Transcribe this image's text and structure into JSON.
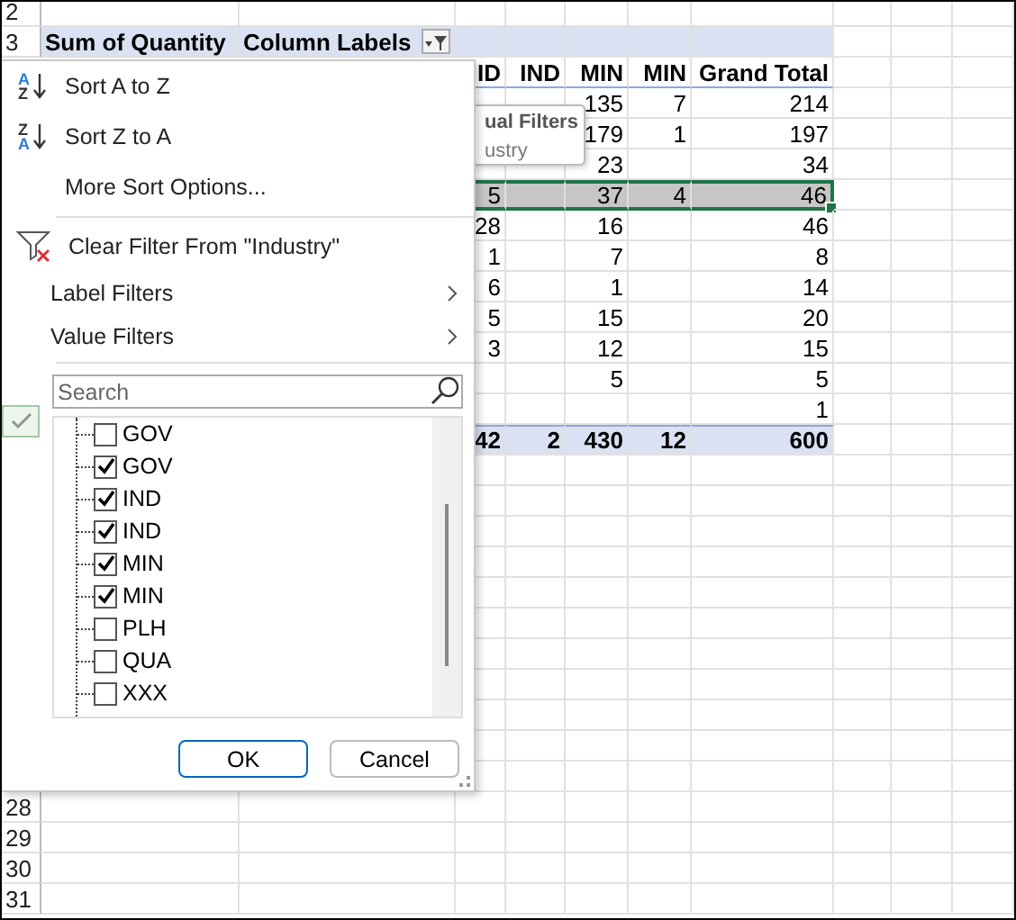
{
  "sheet": {
    "row_headers": [
      "2",
      "3",
      "28",
      "29",
      "30",
      "31"
    ]
  },
  "pivot": {
    "row_label": "Sum of Quantity",
    "column_label": "Column Labels",
    "filter_active": true,
    "columns": [
      "ID",
      "IND",
      "MIN",
      "MIN",
      "Grand Total"
    ],
    "rows": [
      {
        "selected": false,
        "cells": [
          null,
          null,
          "135",
          "7",
          "214"
        ]
      },
      {
        "selected": false,
        "cells": [
          null,
          null,
          "179",
          "1",
          "197"
        ]
      },
      {
        "selected": false,
        "cells": [
          null,
          null,
          "23",
          null,
          "34"
        ]
      },
      {
        "selected": true,
        "cells": [
          "5",
          null,
          "37",
          "4",
          "46"
        ]
      },
      {
        "selected": false,
        "cells": [
          "28",
          null,
          "16",
          null,
          "46"
        ]
      },
      {
        "selected": false,
        "cells": [
          "1",
          null,
          "7",
          null,
          "8"
        ]
      },
      {
        "selected": false,
        "cells": [
          "6",
          null,
          "1",
          null,
          "14"
        ]
      },
      {
        "selected": false,
        "cells": [
          "5",
          null,
          "15",
          null,
          "20"
        ]
      },
      {
        "selected": false,
        "cells": [
          "3",
          null,
          "12",
          null,
          "15"
        ]
      },
      {
        "selected": false,
        "cells": [
          null,
          null,
          "5",
          null,
          "5"
        ]
      },
      {
        "selected": false,
        "cells": [
          null,
          null,
          null,
          null,
          "1"
        ]
      }
    ],
    "total": [
      "42",
      "2",
      "430",
      "12",
      "600"
    ]
  },
  "tooltip": {
    "title": "ual Filters",
    "text": "ustry"
  },
  "filter_menu": {
    "items": [
      {
        "kind": "sort",
        "label": "Sort A to Z",
        "icon_top": "A",
        "icon_bottom": "Z"
      },
      {
        "kind": "sort",
        "label": "Sort Z to A",
        "icon_top": "Z",
        "icon_bottom": "A"
      },
      {
        "kind": "plain",
        "label": "More Sort Options..."
      },
      {
        "kind": "separator"
      },
      {
        "kind": "clear",
        "label": "Clear Filter From \"Industry\""
      },
      {
        "kind": "submenu",
        "label": "Label Filters"
      },
      {
        "kind": "submenu",
        "label": "Value Filters"
      },
      {
        "kind": "separator"
      }
    ],
    "search": {
      "placeholder": "Search"
    },
    "values": [
      {
        "label": "GOV",
        "checked": false
      },
      {
        "label": "GOV",
        "checked": true
      },
      {
        "label": "IND",
        "checked": true
      },
      {
        "label": "IND",
        "checked": true
      },
      {
        "label": "MIN",
        "checked": true
      },
      {
        "label": "MIN",
        "checked": true
      },
      {
        "label": "PLH",
        "checked": false
      },
      {
        "label": "QUA",
        "checked": false
      },
      {
        "label": "XXX",
        "checked": false
      }
    ],
    "buttons": [
      "OK",
      "Cancel"
    ]
  }
}
